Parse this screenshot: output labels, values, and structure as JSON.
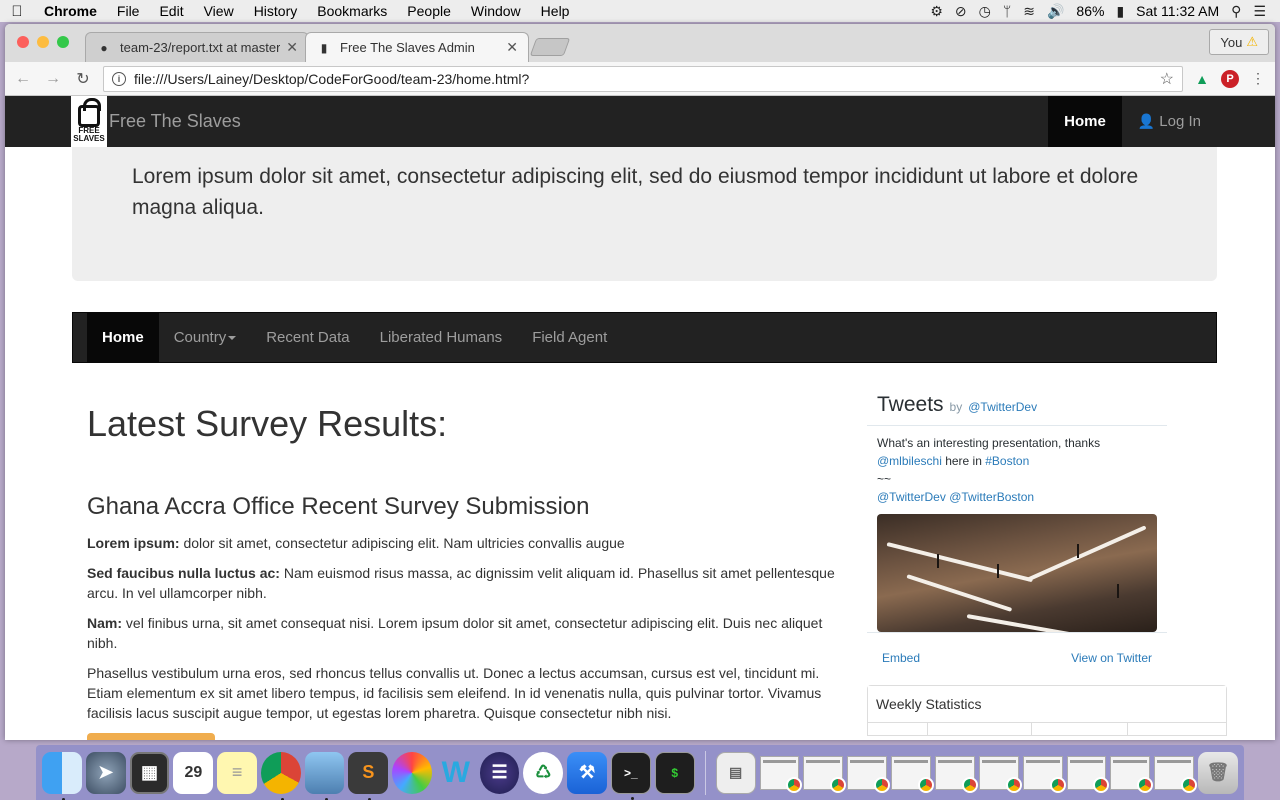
{
  "menubar": {
    "app": "Chrome",
    "items": [
      "File",
      "Edit",
      "View",
      "History",
      "Bookmarks",
      "People",
      "Window",
      "Help"
    ],
    "battery": "86%",
    "clock": "Sat 11:32 AM"
  },
  "browser": {
    "tabs": [
      {
        "title": "team-23/report.txt at master",
        "icon": "github-icon"
      },
      {
        "title": "Free The Slaves Admin",
        "icon": "lock-icon"
      }
    ],
    "profile": "You",
    "url": "file:///Users/Lainey/Desktop/CodeForGood/team-23/home.html?"
  },
  "site": {
    "brand_logo_text": "FREE SLAVES",
    "brand_name": "Free The Slaves",
    "top_nav": {
      "home": "Home",
      "login": "Log In"
    },
    "jumbotron": "Lorem ipsum dolor sit amet, consectetur adipiscing elit, sed do eiusmod tempor incididunt ut labore et dolore magna aliqua.",
    "sub_nav": {
      "home": "Home",
      "country": "Country",
      "recent": "Recent Data",
      "liberated": "Liberated Humans",
      "agent": "Field Agent"
    },
    "heading": "Latest Survey Results:",
    "survey": {
      "title": "Ghana Accra Office Recent Survey Submission",
      "p1_label": "Lorem ipsum:",
      "p1_text": " dolor sit amet, consectetur adipiscing elit. Nam ultricies convallis augue",
      "p2_label": "Sed faucibus nulla luctus ac:",
      "p2_text": " Nam euismod risus massa, ac dignissim velit aliquam id. Phasellus sit amet pellentesque arcu. In vel ullamcorper nibh.",
      "p3_label": "Nam:",
      "p3_text": " vel finibus urna, sit amet consequat nisi. Lorem ipsum dolor sit amet, consectetur adipiscing elit. Duis nec aliquet nibh.",
      "p4_text": "Phasellus vestibulum urna eros, sed rhoncus tellus convallis ut. Donec a lectus accumsan, cursus est vel, tincidunt mi. Etiam elementum ex sit amet libero tempus, id facilisis sem eleifend. In id venenatis nulla, quis pulvinar tortor. Vivamus facilisis lacus suscipit augue tempor, ut egestas lorem pharetra. Quisque consectetur nibh nisi."
    },
    "tweets": {
      "title": "Tweets",
      "by": "by",
      "handle": "@TwitterDev",
      "line1": "What's an interesting presentation, thanks",
      "mention": "@mlbileschi",
      "here_in": " here in ",
      "hashtag": "#Boston",
      "tilde": "~~",
      "m1": "@TwitterDev",
      "m2": "@TwitterBoston",
      "embed": "Embed",
      "view": "View on Twitter"
    },
    "stats_title": "Weekly Statistics"
  },
  "colors": {
    "navbar": "#222222",
    "jumbotron": "#eeeeee",
    "link": "#2b7bb9",
    "warning": "#f0ad4e"
  }
}
